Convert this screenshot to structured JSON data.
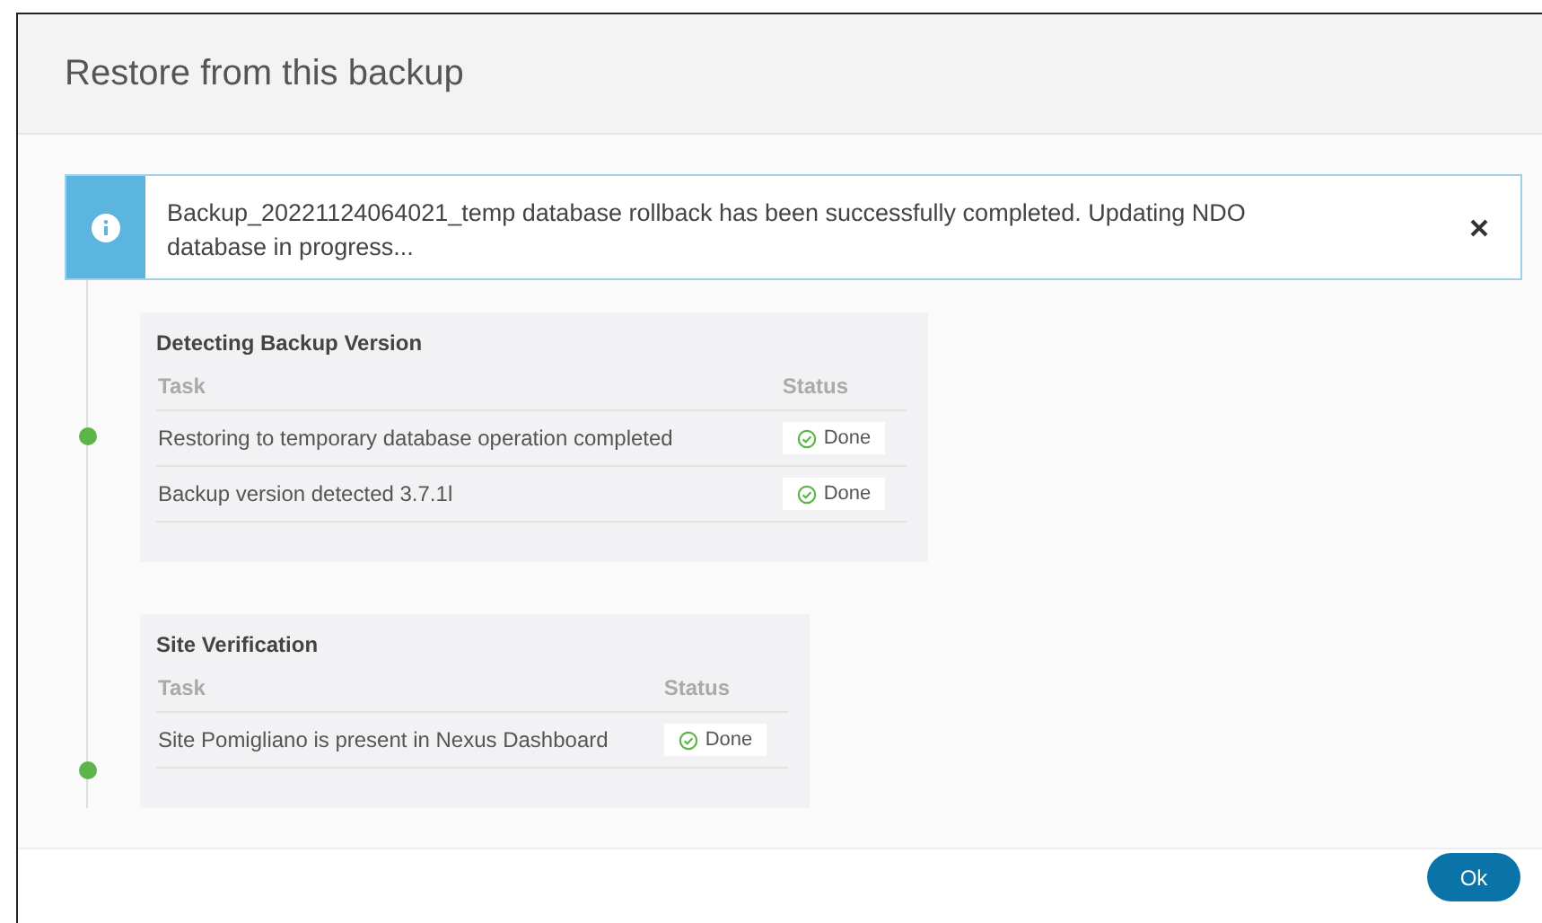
{
  "dialog": {
    "title": "Restore from this backup"
  },
  "alert": {
    "kind": "info",
    "message": "Backup_20221124064021_temp database rollback has been successfully completed. Updating NDO database in progress..."
  },
  "stages": [
    {
      "title": "Detecting Backup Version",
      "done": true,
      "columns": [
        "Task",
        "Status"
      ],
      "rows": [
        {
          "task": "Restoring to temporary database operation completed",
          "status": "Done",
          "kind": "done"
        },
        {
          "task": "Backup version detected 3.7.1l",
          "status": "Done",
          "kind": "done"
        }
      ]
    },
    {
      "title": "Site Verification",
      "done": true,
      "columns": [
        "Task",
        "Status"
      ],
      "rows": [
        {
          "task": "Site Pomigliano is present in Nexus Dashboard",
          "status": "Done",
          "kind": "done"
        }
      ]
    }
  ],
  "buttons": [
    "Ok"
  ]
}
